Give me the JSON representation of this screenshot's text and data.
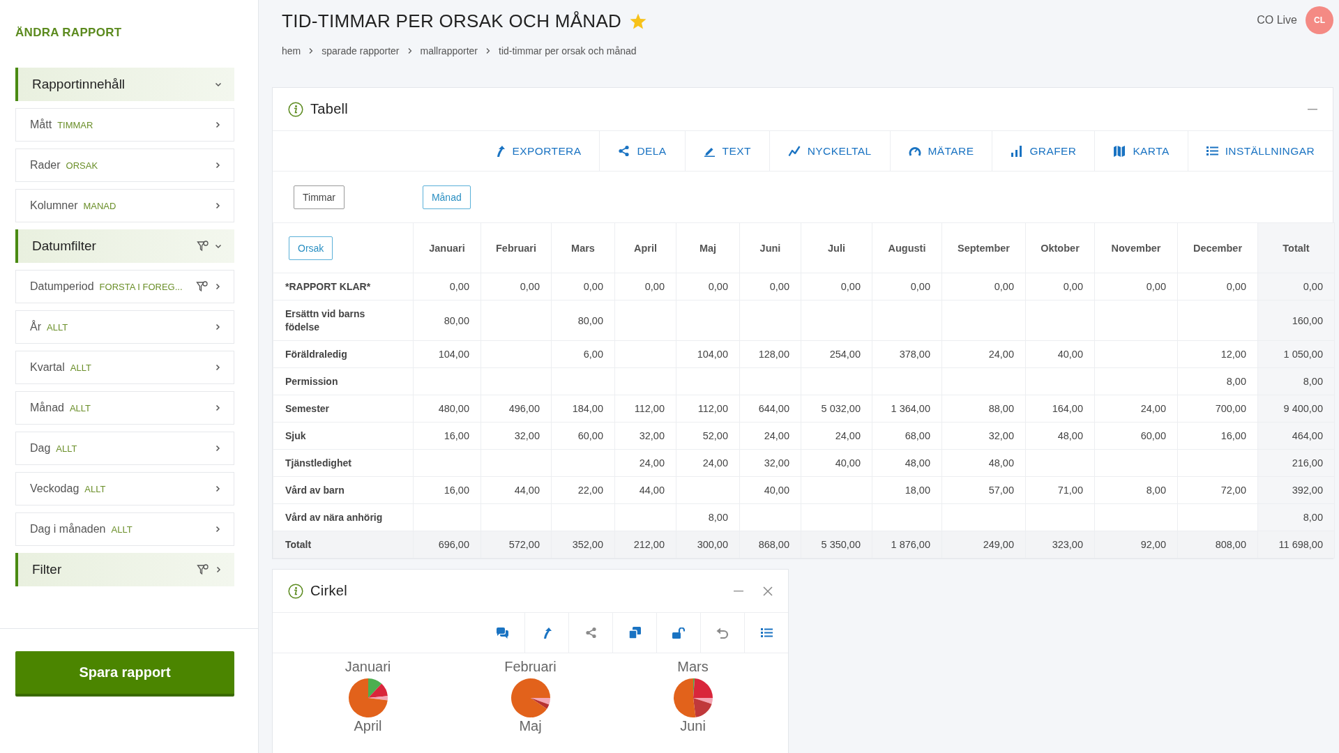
{
  "sidebar": {
    "title": "ÄNDRA RAPPORT",
    "items": [
      {
        "kind": "section",
        "label": "Rapportinnehåll",
        "expanded": true,
        "filtered": false
      },
      {
        "kind": "item",
        "label": "Mått",
        "value": "TIMMAR",
        "filtered": false
      },
      {
        "kind": "item",
        "label": "Rader",
        "value": "ORSAK",
        "filtered": false
      },
      {
        "kind": "item",
        "label": "Kolumner",
        "value": "MANAD",
        "filtered": false
      },
      {
        "kind": "section",
        "label": "Datumfilter",
        "expanded": true,
        "filtered": true
      },
      {
        "kind": "item",
        "label": "Datumperiod",
        "value": "FORSTA I FOREG...",
        "filtered": true
      },
      {
        "kind": "item",
        "label": "År",
        "value": "ALLT",
        "filtered": false
      },
      {
        "kind": "item",
        "label": "Kvartal",
        "value": "ALLT",
        "filtered": false
      },
      {
        "kind": "item",
        "label": "Månad",
        "value": "ALLT",
        "filtered": false
      },
      {
        "kind": "item",
        "label": "Dag",
        "value": "ALLT",
        "filtered": false
      },
      {
        "kind": "item",
        "label": "Veckodag",
        "value": "ALLT",
        "filtered": false
      },
      {
        "kind": "item",
        "label": "Dag i månaden",
        "value": "ALLT",
        "filtered": false
      },
      {
        "kind": "section",
        "label": "Filter",
        "expanded": false,
        "filtered": true
      }
    ],
    "save_button": "Spara rapport"
  },
  "header": {
    "title": "TID-TIMMAR PER ORSAK OCH MÅNAD",
    "favorite": true,
    "breadcrumb": [
      "hem",
      "sparade rapporter",
      "mallrapporter",
      "tid-timmar per orsak och månad"
    ],
    "user": "CO Live",
    "avatar": "CL"
  },
  "table_panel": {
    "title": "Tabell",
    "toolbar": [
      {
        "kind": "export",
        "label": "EXPORTERA"
      },
      {
        "kind": "share",
        "label": "DELA"
      },
      {
        "kind": "text",
        "label": "TEXT"
      },
      {
        "kind": "kpi",
        "label": "NYCKELTAL"
      },
      {
        "kind": "gauge",
        "label": "MÄTARE"
      },
      {
        "kind": "charts",
        "label": "GRAFER"
      },
      {
        "kind": "map",
        "label": "KARTA"
      },
      {
        "kind": "settings",
        "label": "INSTÄLLNINGAR"
      }
    ],
    "measure": "Timmar",
    "column_dimension": "Månad",
    "row_dimension": "Orsak",
    "columns": [
      "Januari",
      "Februari",
      "Mars",
      "April",
      "Maj",
      "Juni",
      "Juli",
      "Augusti",
      "September",
      "Oktober",
      "November",
      "December",
      "Totalt"
    ],
    "rows": [
      {
        "kind": "row",
        "label": "*RAPPORT KLAR*",
        "cells": [
          "0,00",
          "0,00",
          "0,00",
          "0,00",
          "0,00",
          "0,00",
          "0,00",
          "0,00",
          "0,00",
          "0,00",
          "0,00",
          "0,00",
          "0,00"
        ]
      },
      {
        "kind": "row",
        "label": "Ersättn vid barns födelse",
        "cells": [
          "80,00",
          null,
          "80,00",
          null,
          null,
          null,
          null,
          null,
          null,
          null,
          null,
          null,
          "160,00"
        ]
      },
      {
        "kind": "row",
        "label": "Föräldraledig",
        "cells": [
          "104,00",
          null,
          "6,00",
          null,
          "104,00",
          "128,00",
          "254,00",
          "378,00",
          "24,00",
          "40,00",
          null,
          "12,00",
          "1 050,00"
        ]
      },
      {
        "kind": "row",
        "label": "Permission",
        "cells": [
          null,
          null,
          null,
          null,
          null,
          null,
          null,
          null,
          null,
          null,
          null,
          "8,00",
          "8,00"
        ]
      },
      {
        "kind": "row",
        "label": "Semester",
        "cells": [
          "480,00",
          "496,00",
          "184,00",
          "112,00",
          "112,00",
          "644,00",
          "5 032,00",
          "1 364,00",
          "88,00",
          "164,00",
          "24,00",
          "700,00",
          "9 400,00"
        ]
      },
      {
        "kind": "row",
        "label": "Sjuk",
        "cells": [
          "16,00",
          "32,00",
          "60,00",
          "32,00",
          "52,00",
          "24,00",
          "24,00",
          "68,00",
          "32,00",
          "48,00",
          "60,00",
          "16,00",
          "464,00"
        ]
      },
      {
        "kind": "row",
        "label": "Tjänstledighet",
        "cells": [
          null,
          null,
          null,
          "24,00",
          "24,00",
          "32,00",
          "40,00",
          "48,00",
          "48,00",
          null,
          null,
          null,
          "216,00"
        ]
      },
      {
        "kind": "row",
        "label": "Vård av barn",
        "cells": [
          "16,00",
          "44,00",
          "22,00",
          "44,00",
          null,
          "40,00",
          null,
          "18,00",
          "57,00",
          "71,00",
          "8,00",
          "72,00",
          "392,00"
        ]
      },
      {
        "kind": "row",
        "label": "Vård av nära anhörig",
        "cells": [
          null,
          null,
          null,
          null,
          "8,00",
          null,
          null,
          null,
          null,
          null,
          null,
          null,
          "8,00"
        ]
      },
      {
        "kind": "total",
        "label": "Totalt",
        "cells": [
          "696,00",
          "572,00",
          "352,00",
          "212,00",
          "300,00",
          "868,00",
          "5 350,00",
          "1 876,00",
          "249,00",
          "323,00",
          "92,00",
          "808,00",
          "11 698,00"
        ]
      }
    ]
  },
  "pie_panel": {
    "title": "Cirkel",
    "toolbar": [
      {
        "kind": "comments",
        "disabled": false
      },
      {
        "kind": "export",
        "disabled": false
      },
      {
        "kind": "share",
        "disabled": true
      },
      {
        "kind": "copy",
        "disabled": false
      },
      {
        "kind": "unlock",
        "disabled": false
      },
      {
        "kind": "undo",
        "disabled": true
      },
      {
        "kind": "list",
        "disabled": false
      }
    ],
    "pies": [
      {
        "label": "Januari"
      },
      {
        "label": "Februari"
      },
      {
        "label": "Mars"
      },
      {
        "label": "April"
      },
      {
        "label": "Maj"
      },
      {
        "label": "Juni"
      }
    ]
  }
}
